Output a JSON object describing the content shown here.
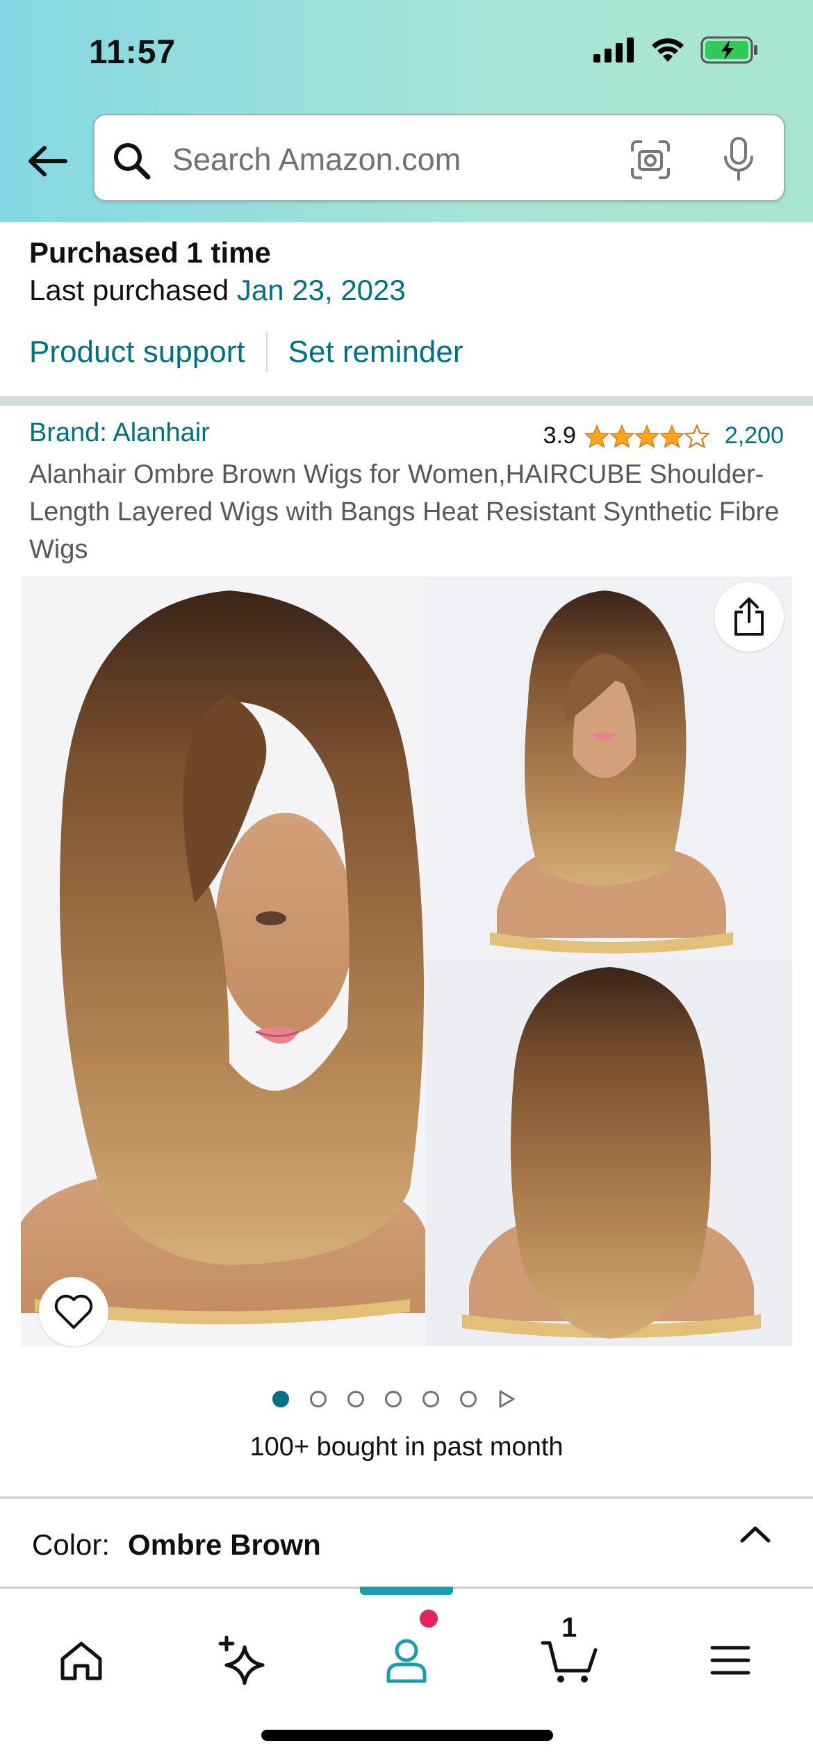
{
  "status_bar": {
    "time": "11:57"
  },
  "search": {
    "placeholder": "Search Amazon.com"
  },
  "purchase_info": {
    "times": "Purchased 1 time",
    "last_label": "Last purchased",
    "last_date": "Jan 23, 2023",
    "product_support": "Product support",
    "set_reminder": "Set reminder"
  },
  "product": {
    "brand": "Brand: Alanhair",
    "rating": "3.9",
    "stars": 3.9,
    "review_count": "2,200",
    "title": "Alanhair Ombre Brown Wigs for Women,HAIRCUBE Shoulder-Length Layered Wigs with Bangs Heat Resistant Synthetic Fibre Wigs",
    "bought_badge": "100+ bought in past month",
    "color_label": "Color:",
    "color_value": "Ombre Brown"
  },
  "pager": {
    "total_dots": 6,
    "active_index": 0
  },
  "bottom_nav": {
    "cart_count": "1",
    "active": "account"
  },
  "colors": {
    "link": "#007185",
    "star": "#ffa41c",
    "accent": "#1c9dad"
  }
}
